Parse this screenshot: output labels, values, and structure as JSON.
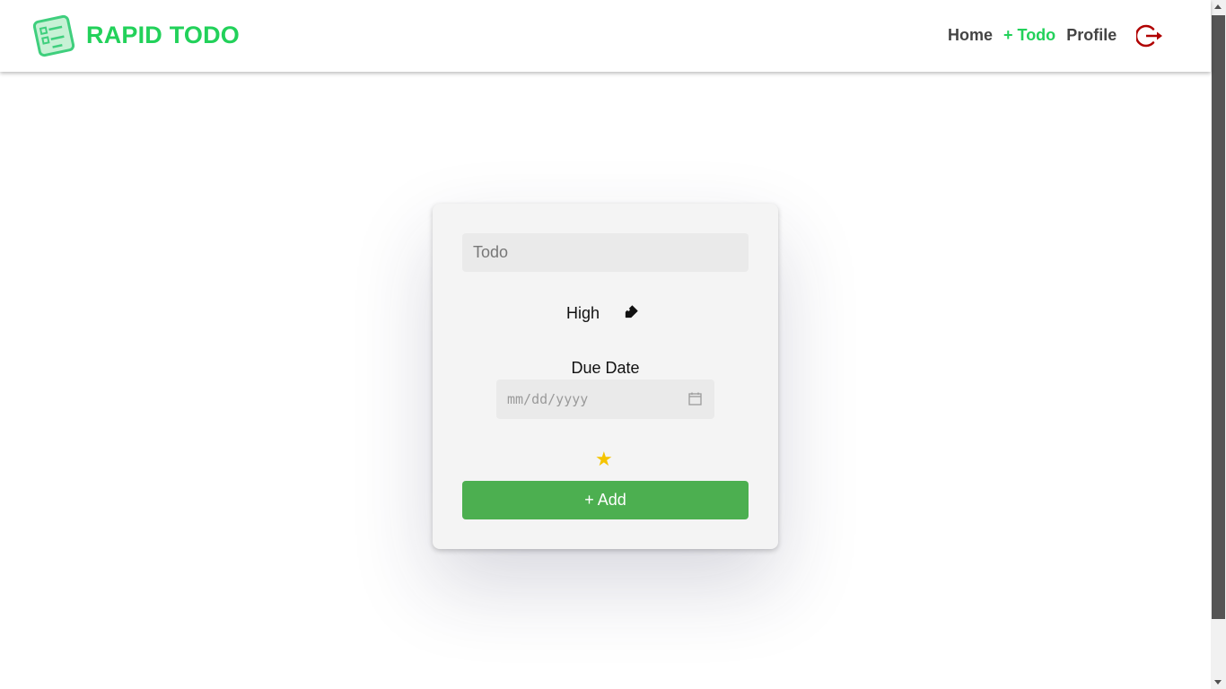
{
  "header": {
    "brand": "RAPID TODO",
    "logo_icon": "todo-list-logo-icon",
    "brand_color": "#22d15a",
    "nav": {
      "home": "Home",
      "todo": "+ Todo",
      "profile": "Profile"
    },
    "logout_icon": "logout-icon",
    "logout_color": "#b00000"
  },
  "form": {
    "todo_placeholder": "Todo",
    "priority_label": "High",
    "priority_icon": "tag-icon",
    "due_date_label": "Due Date",
    "date_placeholder": "mm/dd/yyyy",
    "calendar_icon": "calendar-icon",
    "star_icon": "star-icon",
    "star_color": "#f5c400",
    "add_button_label": "+ Add",
    "add_button_color": "#4caf50"
  }
}
